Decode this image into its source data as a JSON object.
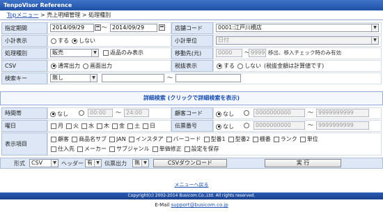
{
  "app_title": "TenpoVisor Reference",
  "breadcrumb": {
    "top": "Topメニュー",
    "sep1": ">",
    "level2": "売上明細管理",
    "sep2": ">",
    "current": "処理種別"
  },
  "form": {
    "period": {
      "label": "指定期間",
      "from": "2014/09/29",
      "tilde": "～",
      "to": "2014/09/29"
    },
    "store": {
      "label": "店舗コード",
      "value": "0001:江戸川橋店"
    },
    "subtotal": {
      "label": "小計表示",
      "opt1": "する",
      "opt2": "しない"
    },
    "subtotal_unit": {
      "label": "小計単位",
      "value": "日付"
    },
    "proc": {
      "label": "処理種別",
      "value": "販売",
      "return_label": "返品のみ表示"
    },
    "move": {
      "label": "移動先(元)",
      "from": "0000",
      "to": "9999",
      "note": "移出、移入チェック時のみ有効"
    },
    "csv": {
      "label": "CSV",
      "opt1": "通常出力",
      "opt2": "画面出力"
    },
    "tax": {
      "label": "税抜表示",
      "opt1": "する",
      "opt2": "しない",
      "note": "(税抜金額は計算値です)"
    },
    "search_key": {
      "label": "検索キー",
      "value": "無し",
      "tilde": "～"
    }
  },
  "detail": {
    "header": "詳細検索 (クリックで詳細検索を表示)",
    "time": {
      "label": "時間帯",
      "opt1": "なし",
      "from": "00:00",
      "tilde": "～",
      "to": "24:00"
    },
    "customer": {
      "label": "顧客コード",
      "opt1": "なし",
      "from": "0000000000",
      "tilde": "～",
      "to": "9999999999"
    },
    "weekday": {
      "label": "曜日",
      "days": [
        "月",
        "火",
        "水",
        "木",
        "金",
        "土",
        "日"
      ]
    },
    "slip": {
      "label": "伝票番号",
      "opt1": "なし",
      "from": "0000000000",
      "tilde": "～",
      "to": "9999999999"
    },
    "display": {
      "label": "表示項目",
      "row1": [
        "顧客",
        "商品名サブ",
        "JAN",
        "インスタア",
        "バーコード",
        "型番1",
        "型番2",
        "棚番",
        "ランク",
        "単位"
      ],
      "row2": [
        "仕入先",
        "メーカー",
        "サブジャンル",
        "単価修正",
        "設定を保存"
      ]
    }
  },
  "bottom": {
    "format_label": "形式",
    "format_value": "CSV",
    "header_label": "ヘッダー",
    "header_value": "有",
    "slip_out_label": "伝票出力",
    "slip_out_value": "無",
    "csv_download": "CSVダウンロード",
    "execute": "実 行"
  },
  "back_to_menu": "メニューへ戻る",
  "copyright": "Copyright(c) 2002-2014 Busicom.Co.,Ltd. All rights reserved.",
  "email_label": "E-Mail",
  "email": "support@busicom.co.jp"
}
